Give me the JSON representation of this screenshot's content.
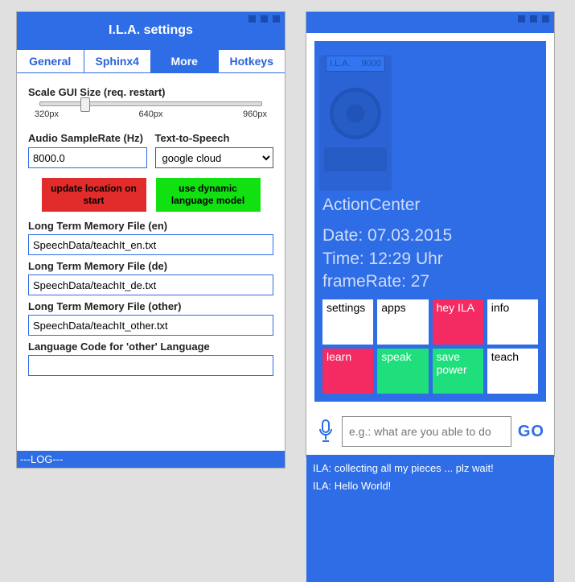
{
  "settingsWindow": {
    "title": "I.L.A. settings",
    "tabs": [
      "General",
      "Sphinx4",
      "More",
      "Hotkeys"
    ],
    "scaleLabel": "Scale GUI Size (req. restart)",
    "scaleTicks": [
      "320px",
      "640px",
      "960px"
    ],
    "sampleRateLabel": "Audio SampleRate (Hz)",
    "sampleRateValue": "8000.0",
    "ttsLabel": "Text-to-Speech",
    "ttsValue": "google cloud",
    "btnUpdateLoc": "update location on start",
    "btnDynLang": "use dynamic language model",
    "memEnLabel": "Long Term Memory File (en)",
    "memEnValue": "SpeechData/teachIt_en.txt",
    "memDeLabel": "Long Term Memory File (de)",
    "memDeValue": "SpeechData/teachIt_de.txt",
    "memOtherLabel": "Long Term Memory File (other)",
    "memOtherValue": "SpeechData/teachIt_other.txt",
    "langCodeLabel": "Language Code for 'other' Language",
    "langCodeValue": "",
    "logLabel": "---LOG---"
  },
  "actionCenter": {
    "title": "ActionCenter",
    "dateLine": "Date: 07.03.2015",
    "timeLine": "Time: 12:29 Uhr",
    "frameLine": "frameRate: 27",
    "deviceLabelL": "I.L.A.",
    "deviceLabelR": "9000",
    "tiles": [
      {
        "label": "settings",
        "cls": ""
      },
      {
        "label": "apps",
        "cls": ""
      },
      {
        "label": "hey ILA",
        "cls": "pink"
      },
      {
        "label": "info",
        "cls": ""
      },
      {
        "label": "learn",
        "cls": "pink"
      },
      {
        "label": "speak",
        "cls": "green"
      },
      {
        "label": "save power",
        "cls": "green"
      },
      {
        "label": "teach",
        "cls": ""
      }
    ],
    "askPlaceholder": "e.g.: what are you able to do",
    "goLabel": "GO",
    "consoleLines": [
      "ILA: collecting all my pieces ... plz wait!",
      "ILA: Hello World!"
    ]
  }
}
